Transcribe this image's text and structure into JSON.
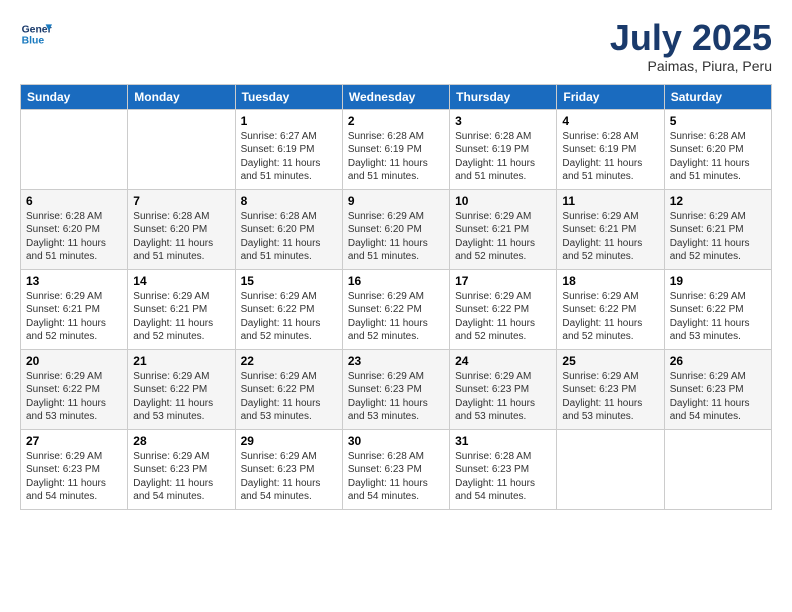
{
  "logo": {
    "line1": "General",
    "line2": "Blue"
  },
  "header": {
    "month": "July 2025",
    "location": "Paimas, Piura, Peru"
  },
  "weekdays": [
    "Sunday",
    "Monday",
    "Tuesday",
    "Wednesday",
    "Thursday",
    "Friday",
    "Saturday"
  ],
  "weeks": [
    [
      {
        "day": "",
        "info": ""
      },
      {
        "day": "",
        "info": ""
      },
      {
        "day": "1",
        "info": "Sunrise: 6:27 AM\nSunset: 6:19 PM\nDaylight: 11 hours and 51 minutes."
      },
      {
        "day": "2",
        "info": "Sunrise: 6:28 AM\nSunset: 6:19 PM\nDaylight: 11 hours and 51 minutes."
      },
      {
        "day": "3",
        "info": "Sunrise: 6:28 AM\nSunset: 6:19 PM\nDaylight: 11 hours and 51 minutes."
      },
      {
        "day": "4",
        "info": "Sunrise: 6:28 AM\nSunset: 6:19 PM\nDaylight: 11 hours and 51 minutes."
      },
      {
        "day": "5",
        "info": "Sunrise: 6:28 AM\nSunset: 6:20 PM\nDaylight: 11 hours and 51 minutes."
      }
    ],
    [
      {
        "day": "6",
        "info": "Sunrise: 6:28 AM\nSunset: 6:20 PM\nDaylight: 11 hours and 51 minutes."
      },
      {
        "day": "7",
        "info": "Sunrise: 6:28 AM\nSunset: 6:20 PM\nDaylight: 11 hours and 51 minutes."
      },
      {
        "day": "8",
        "info": "Sunrise: 6:28 AM\nSunset: 6:20 PM\nDaylight: 11 hours and 51 minutes."
      },
      {
        "day": "9",
        "info": "Sunrise: 6:29 AM\nSunset: 6:20 PM\nDaylight: 11 hours and 51 minutes."
      },
      {
        "day": "10",
        "info": "Sunrise: 6:29 AM\nSunset: 6:21 PM\nDaylight: 11 hours and 52 minutes."
      },
      {
        "day": "11",
        "info": "Sunrise: 6:29 AM\nSunset: 6:21 PM\nDaylight: 11 hours and 52 minutes."
      },
      {
        "day": "12",
        "info": "Sunrise: 6:29 AM\nSunset: 6:21 PM\nDaylight: 11 hours and 52 minutes."
      }
    ],
    [
      {
        "day": "13",
        "info": "Sunrise: 6:29 AM\nSunset: 6:21 PM\nDaylight: 11 hours and 52 minutes."
      },
      {
        "day": "14",
        "info": "Sunrise: 6:29 AM\nSunset: 6:21 PM\nDaylight: 11 hours and 52 minutes."
      },
      {
        "day": "15",
        "info": "Sunrise: 6:29 AM\nSunset: 6:22 PM\nDaylight: 11 hours and 52 minutes."
      },
      {
        "day": "16",
        "info": "Sunrise: 6:29 AM\nSunset: 6:22 PM\nDaylight: 11 hours and 52 minutes."
      },
      {
        "day": "17",
        "info": "Sunrise: 6:29 AM\nSunset: 6:22 PM\nDaylight: 11 hours and 52 minutes."
      },
      {
        "day": "18",
        "info": "Sunrise: 6:29 AM\nSunset: 6:22 PM\nDaylight: 11 hours and 52 minutes."
      },
      {
        "day": "19",
        "info": "Sunrise: 6:29 AM\nSunset: 6:22 PM\nDaylight: 11 hours and 53 minutes."
      }
    ],
    [
      {
        "day": "20",
        "info": "Sunrise: 6:29 AM\nSunset: 6:22 PM\nDaylight: 11 hours and 53 minutes."
      },
      {
        "day": "21",
        "info": "Sunrise: 6:29 AM\nSunset: 6:22 PM\nDaylight: 11 hours and 53 minutes."
      },
      {
        "day": "22",
        "info": "Sunrise: 6:29 AM\nSunset: 6:22 PM\nDaylight: 11 hours and 53 minutes."
      },
      {
        "day": "23",
        "info": "Sunrise: 6:29 AM\nSunset: 6:23 PM\nDaylight: 11 hours and 53 minutes."
      },
      {
        "day": "24",
        "info": "Sunrise: 6:29 AM\nSunset: 6:23 PM\nDaylight: 11 hours and 53 minutes."
      },
      {
        "day": "25",
        "info": "Sunrise: 6:29 AM\nSunset: 6:23 PM\nDaylight: 11 hours and 53 minutes."
      },
      {
        "day": "26",
        "info": "Sunrise: 6:29 AM\nSunset: 6:23 PM\nDaylight: 11 hours and 54 minutes."
      }
    ],
    [
      {
        "day": "27",
        "info": "Sunrise: 6:29 AM\nSunset: 6:23 PM\nDaylight: 11 hours and 54 minutes."
      },
      {
        "day": "28",
        "info": "Sunrise: 6:29 AM\nSunset: 6:23 PM\nDaylight: 11 hours and 54 minutes."
      },
      {
        "day": "29",
        "info": "Sunrise: 6:29 AM\nSunset: 6:23 PM\nDaylight: 11 hours and 54 minutes."
      },
      {
        "day": "30",
        "info": "Sunrise: 6:28 AM\nSunset: 6:23 PM\nDaylight: 11 hours and 54 minutes."
      },
      {
        "day": "31",
        "info": "Sunrise: 6:28 AM\nSunset: 6:23 PM\nDaylight: 11 hours and 54 minutes."
      },
      {
        "day": "",
        "info": ""
      },
      {
        "day": "",
        "info": ""
      }
    ]
  ]
}
